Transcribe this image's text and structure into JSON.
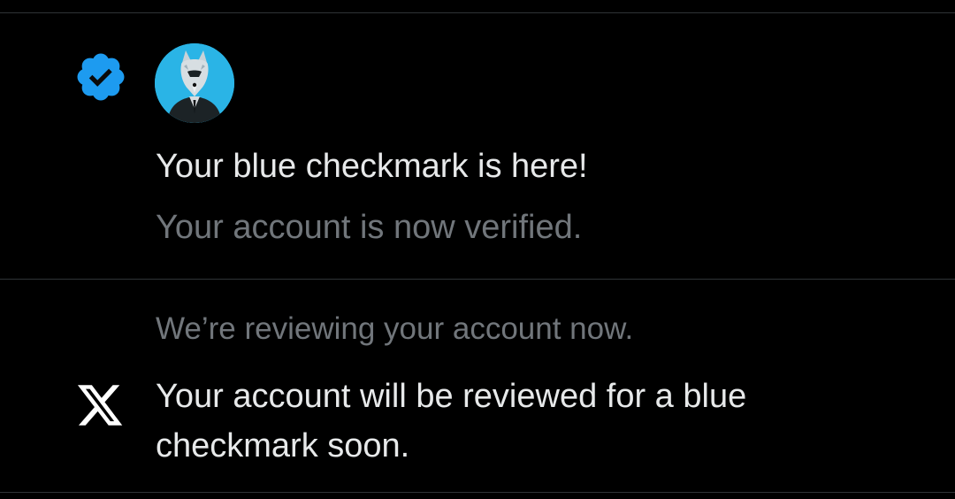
{
  "notifications": [
    {
      "icon": "verified-badge-icon",
      "icon_color": "#1d9bf0",
      "avatar": "wolf-in-suit-avatar",
      "title": "Your blue checkmark is here!",
      "subtitle": "Your account is now verified."
    },
    {
      "icon": "x-logo-icon",
      "preface": "We’re reviewing your account now.",
      "title": "Your account will be reviewed for a blue checkmark soon."
    }
  ],
  "colors": {
    "background": "#000000",
    "primary_text": "#e7e9ea",
    "secondary_text": "#71767b",
    "divider": "#2f3336",
    "accent": "#1d9bf0"
  }
}
